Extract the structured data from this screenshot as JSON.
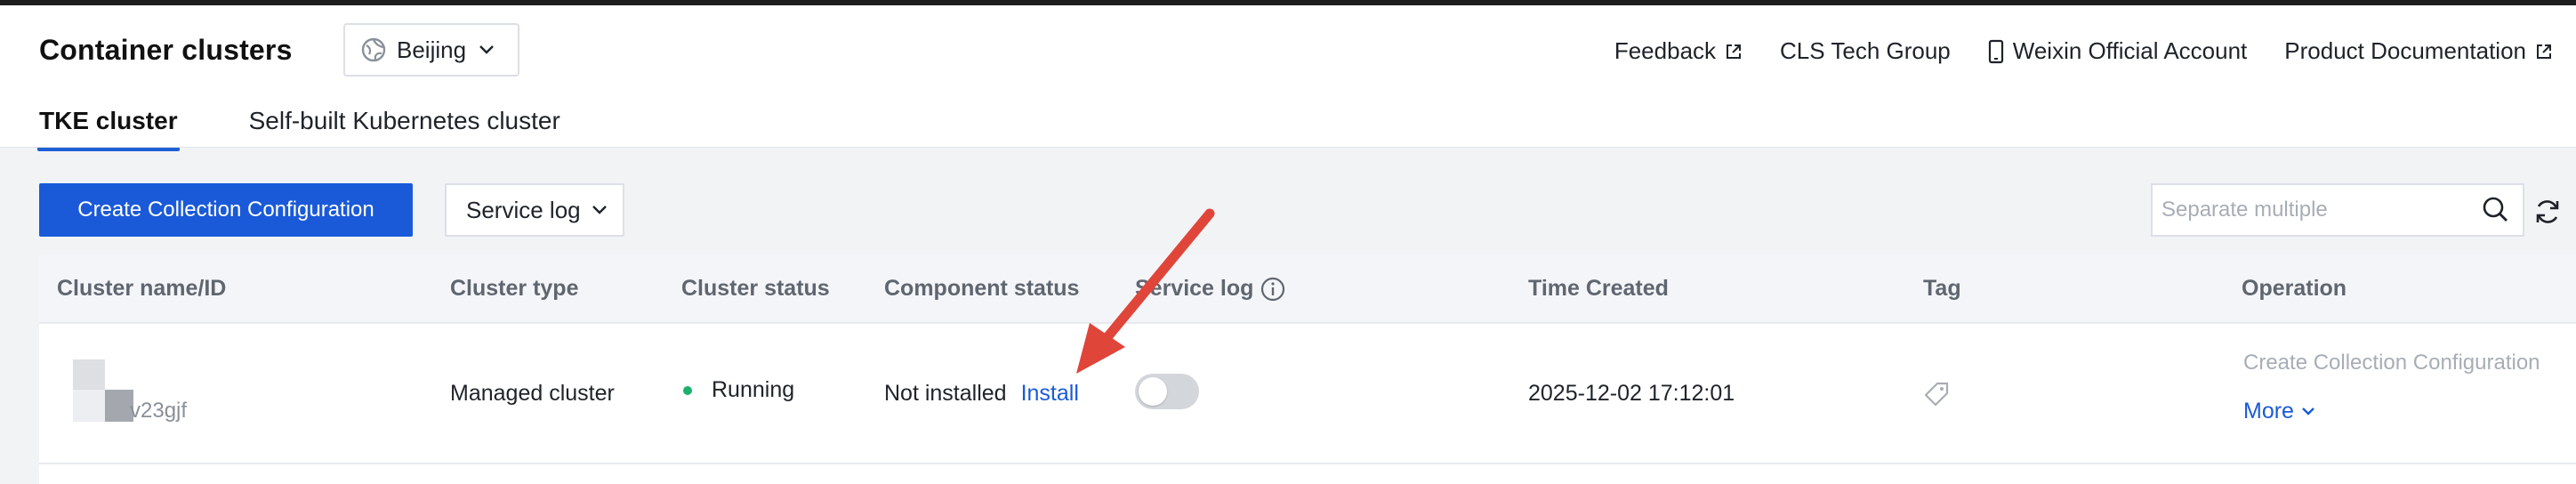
{
  "header": {
    "title": "Container clusters",
    "region": "Beijing",
    "links": {
      "feedback": "Feedback",
      "tech_group": "CLS Tech Group",
      "weixin": "Weixin Official Account",
      "docs": "Product Documentation"
    },
    "tabs": [
      "TKE cluster",
      "Self-built Kubernetes cluster"
    ],
    "active_tab": "TKE cluster"
  },
  "toolbar": {
    "create_label": "Create Collection Configuration",
    "log_type": "Service log",
    "search_placeholder": "Separate multiple"
  },
  "table": {
    "columns": [
      "Cluster name/ID",
      "Cluster type",
      "Cluster status",
      "Component status",
      "Service log",
      "Time Created",
      "Tag",
      "Operation"
    ],
    "rows": [
      {
        "cluster_id": "v23gjf",
        "cluster_type": "Managed cluster",
        "status": "Running",
        "component_status": "Not installed",
        "install_label": "Install",
        "service_log_enabled": false,
        "time_created": "2025-12-02 17:12:01",
        "op_create": "Create Collection Configuration",
        "op_more": "More"
      }
    ]
  },
  "colors": {
    "primary": "#1a5ad9",
    "running": "#1bb16a",
    "annotation_arrow": "#e0453a"
  }
}
